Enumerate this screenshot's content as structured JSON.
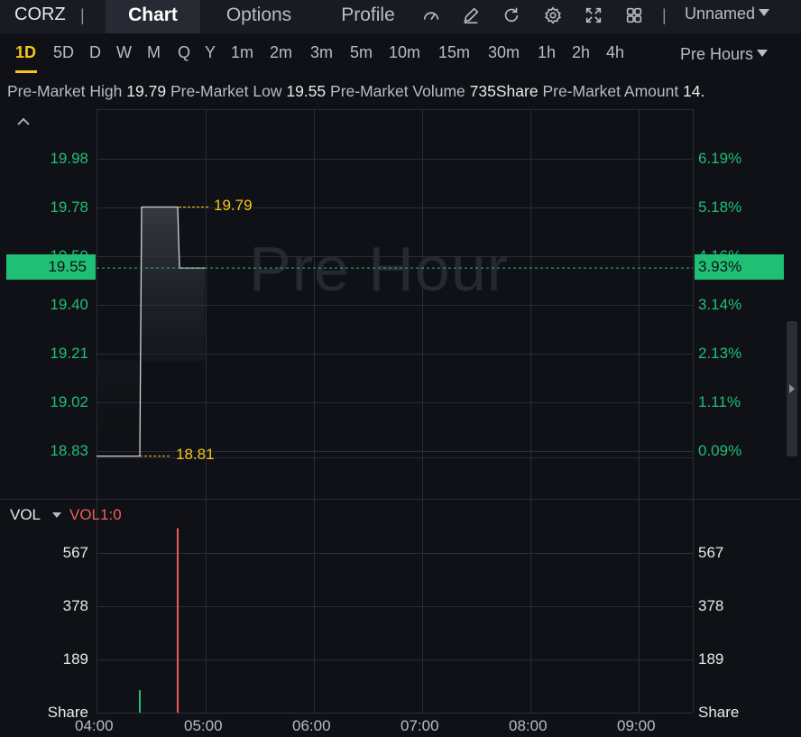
{
  "header": {
    "ticker": "CORZ",
    "separator": "|",
    "tabs": [
      {
        "label": "Chart"
      },
      {
        "label": "Options"
      },
      {
        "label": "Profile"
      }
    ],
    "tools": [
      "gauge-icon",
      "pencil-icon",
      "refresh-icon",
      "gear-icon",
      "fullscreen-icon",
      "grid-icon"
    ],
    "layout_name": "Unnamed"
  },
  "periods": [
    "1D",
    "5D",
    "D",
    "W",
    "M",
    "Q",
    "Y",
    "1m",
    "2m",
    "3m",
    "5m",
    "10m",
    "15m",
    "30m",
    "1h",
    "2h",
    "4h"
  ],
  "session": "Pre Hours",
  "info": {
    "high_label": "Pre-Market High",
    "high_value": "19.79",
    "low_label": "Pre-Market Low",
    "low_value": "19.55",
    "volume_label": "Pre-Market Volume",
    "volume_value": "735Share",
    "amount_label": "Pre-Market Amount",
    "amount_value": "14."
  },
  "chart": {
    "watermark": "Pre Hour",
    "left_ticks": [
      "19.98",
      "19.78",
      "19.59",
      "19.40",
      "19.21",
      "19.02",
      "18.83"
    ],
    "right_ticks": [
      "6.19%",
      "5.18%",
      "4.16%",
      "3.14%",
      "2.13%",
      "1.11%",
      "0.09%"
    ],
    "current_price": "19.55",
    "current_pct": "3.93%",
    "high_marker": "19.79",
    "low_marker": "18.81",
    "x_ticks": [
      "04:00",
      "05:00",
      "06:00",
      "07:00",
      "08:00",
      "09:00"
    ],
    "colors": {
      "up": "#1fbf75",
      "down": "#e8605a",
      "marker": "#f5c518"
    }
  },
  "volume": {
    "label": "VOL",
    "indicator": "VOL1:0",
    "left_ticks": [
      "567",
      "378",
      "189",
      "Share"
    ],
    "right_ticks": [
      "567",
      "378",
      "189",
      "Share"
    ]
  },
  "chart_data": {
    "type": "line",
    "x": [
      "04:00",
      "04:24",
      "04:25",
      "04:45",
      "04:46",
      "05:00"
    ],
    "values": [
      18.81,
      18.81,
      19.79,
      19.79,
      19.55,
      19.55
    ],
    "ylim": [
      18.83,
      19.98
    ],
    "volume": [
      {
        "x": "04:24",
        "value": 80,
        "color": "#1fbf75"
      },
      {
        "x": "04:45",
        "value": 655,
        "color": "#e8605a"
      }
    ]
  }
}
